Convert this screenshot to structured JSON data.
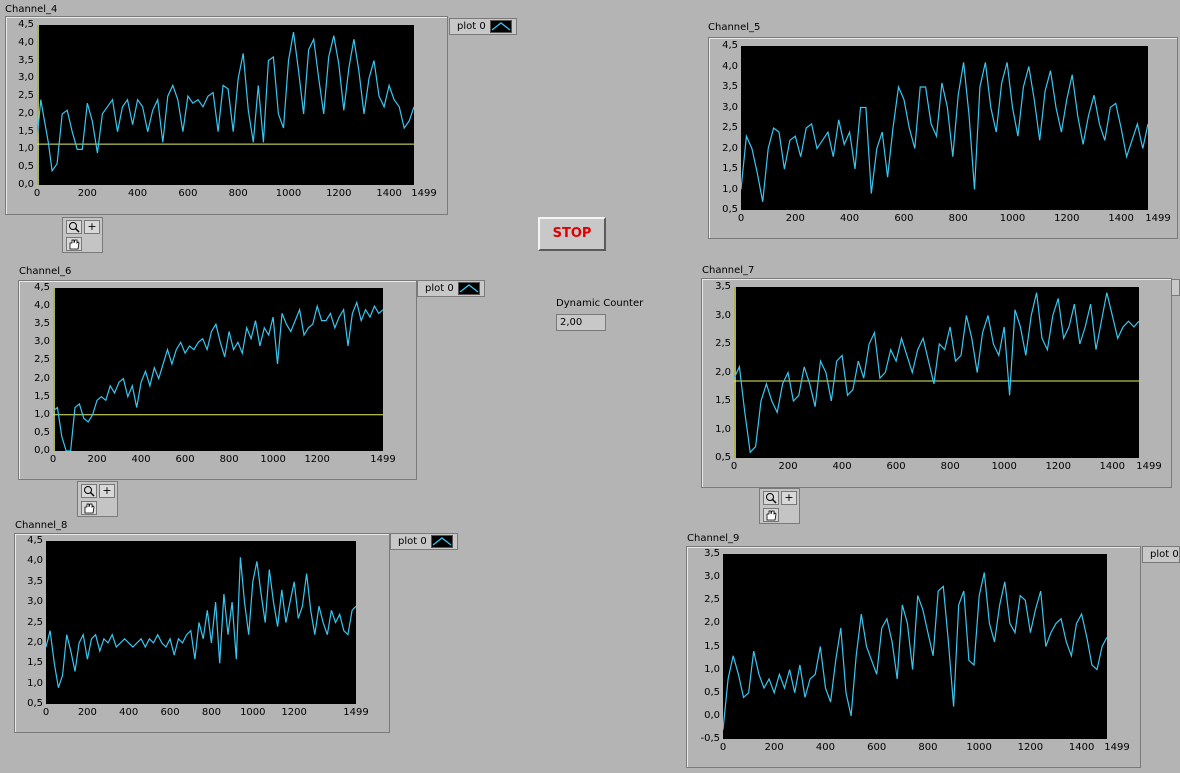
{
  "stop_button": {
    "label": "STOP"
  },
  "dynamic_counter": {
    "label": "Dynamic Counter",
    "value": "2,00"
  },
  "colors": {
    "trace": "#39c6f0",
    "cursor": "#e6f064",
    "plot_bg": "#000000"
  },
  "charts": [
    {
      "id": "ch4",
      "title": "Channel_4",
      "legend": "plot 0",
      "palette": true,
      "yticks": [
        "4,5",
        "4,0",
        "3,5",
        "3,0",
        "2,5",
        "2,0",
        "1,5",
        "1,0",
        "0,5",
        "0,0"
      ],
      "xticks": [
        "0",
        "200",
        "400",
        "600",
        "800",
        "1000",
        "1200",
        "1400",
        "1499"
      ],
      "chart_data": {
        "type": "line",
        "x_range": [
          0,
          1499
        ],
        "y_range": [
          0,
          4.5
        ],
        "cursor_y": 1.15,
        "x": [
          0,
          15,
          30,
          45,
          60,
          80,
          100,
          120,
          140,
          160,
          180,
          200,
          220,
          240,
          260,
          280,
          300,
          320,
          340,
          360,
          380,
          400,
          420,
          440,
          460,
          480,
          500,
          520,
          540,
          560,
          580,
          600,
          620,
          640,
          660,
          680,
          700,
          720,
          740,
          760,
          780,
          800,
          820,
          840,
          860,
          880,
          900,
          920,
          940,
          960,
          980,
          1000,
          1020,
          1040,
          1060,
          1080,
          1100,
          1120,
          1140,
          1160,
          1180,
          1200,
          1220,
          1240,
          1260,
          1280,
          1300,
          1320,
          1340,
          1360,
          1380,
          1400,
          1420,
          1440,
          1460,
          1480,
          1499
        ],
        "y": [
          1.3,
          2.4,
          1.8,
          1.2,
          0.4,
          0.6,
          2.0,
          2.1,
          1.5,
          1.0,
          1.0,
          2.3,
          1.8,
          0.9,
          2.0,
          2.2,
          2.4,
          1.5,
          2.2,
          2.4,
          1.7,
          2.4,
          2.2,
          1.5,
          2.1,
          2.4,
          1.2,
          2.5,
          2.8,
          2.4,
          1.5,
          2.5,
          2.3,
          2.4,
          2.2,
          2.5,
          2.6,
          1.5,
          2.8,
          2.7,
          1.5,
          3.0,
          3.7,
          2.1,
          1.2,
          2.8,
          1.2,
          3.5,
          3.6,
          2.0,
          1.6,
          3.5,
          4.3,
          3.2,
          2.0,
          3.8,
          4.1,
          3.0,
          2.0,
          3.6,
          4.2,
          3.4,
          2.1,
          3.3,
          4.1,
          3.2,
          2.0,
          3.0,
          3.5,
          2.5,
          2.2,
          2.8,
          2.4,
          2.2,
          1.6,
          1.8,
          2.2
        ]
      }
    },
    {
      "id": "ch5",
      "title": "Channel_5",
      "legend": "",
      "palette": false,
      "yticks": [
        "4,5",
        "4,0",
        "3,5",
        "3,0",
        "2,5",
        "2,0",
        "1,5",
        "1,0",
        "0,5"
      ],
      "xticks": [
        "0",
        "200",
        "400",
        "600",
        "800",
        "1000",
        "1200",
        "1400",
        "1499"
      ],
      "chart_data": {
        "type": "line",
        "x_range": [
          0,
          1499
        ],
        "y_range": [
          0.5,
          4.5
        ],
        "x": [
          0,
          20,
          40,
          60,
          80,
          100,
          120,
          140,
          160,
          180,
          200,
          220,
          240,
          260,
          280,
          300,
          320,
          340,
          360,
          380,
          400,
          420,
          440,
          460,
          480,
          500,
          520,
          540,
          560,
          580,
          600,
          620,
          640,
          660,
          680,
          700,
          720,
          740,
          760,
          780,
          800,
          820,
          840,
          860,
          880,
          900,
          920,
          940,
          960,
          980,
          1000,
          1020,
          1040,
          1060,
          1080,
          1100,
          1120,
          1140,
          1160,
          1180,
          1200,
          1220,
          1240,
          1260,
          1280,
          1300,
          1320,
          1340,
          1360,
          1380,
          1400,
          1420,
          1440,
          1460,
          1480,
          1499
        ],
        "y": [
          1.0,
          2.3,
          2.0,
          1.4,
          0.7,
          2.0,
          2.5,
          2.4,
          1.5,
          2.2,
          2.3,
          1.8,
          2.5,
          2.6,
          2.0,
          2.2,
          2.4,
          1.8,
          2.7,
          2.1,
          2.4,
          1.5,
          3.0,
          3.0,
          0.9,
          2.0,
          2.4,
          1.3,
          2.5,
          3.5,
          3.2,
          2.5,
          2.0,
          3.5,
          3.5,
          2.6,
          2.3,
          3.6,
          3.0,
          1.8,
          3.3,
          4.1,
          2.8,
          1.0,
          3.5,
          4.1,
          3.0,
          2.4,
          3.6,
          4.1,
          3.0,
          2.3,
          3.5,
          4.0,
          3.2,
          2.2,
          3.4,
          3.9,
          3.0,
          2.4,
          3.2,
          3.8,
          2.8,
          2.1,
          2.8,
          3.3,
          2.6,
          2.2,
          3.0,
          3.1,
          2.5,
          1.8,
          2.2,
          2.6,
          2.0,
          2.6
        ]
      }
    },
    {
      "id": "ch6",
      "title": "Channel_6",
      "legend": "plot 0",
      "palette": true,
      "yticks": [
        "4,5",
        "4,0",
        "3,5",
        "3,0",
        "2,5",
        "2,0",
        "1,5",
        "1,0",
        "0,5",
        "0,0"
      ],
      "xticks": [
        "0",
        "200",
        "400",
        "600",
        "800",
        "1000",
        "1200",
        "1499"
      ],
      "chart_data": {
        "type": "line",
        "x_range": [
          0,
          1499
        ],
        "y_range": [
          0,
          4.5
        ],
        "cursor_y": 1.0,
        "x": [
          0,
          20,
          40,
          60,
          80,
          100,
          120,
          140,
          160,
          180,
          200,
          220,
          240,
          260,
          280,
          300,
          320,
          340,
          360,
          380,
          400,
          420,
          440,
          460,
          480,
          500,
          520,
          540,
          560,
          580,
          600,
          620,
          640,
          660,
          680,
          700,
          720,
          740,
          760,
          780,
          800,
          820,
          840,
          860,
          880,
          900,
          920,
          940,
          960,
          980,
          1000,
          1020,
          1040,
          1060,
          1080,
          1100,
          1120,
          1140,
          1160,
          1180,
          1200,
          1220,
          1240,
          1260,
          1280,
          1300,
          1320,
          1340,
          1360,
          1380,
          1400,
          1420,
          1440,
          1460,
          1480,
          1499
        ],
        "y": [
          1.1,
          1.2,
          0.4,
          0.0,
          0.0,
          1.2,
          1.3,
          0.9,
          0.8,
          1.0,
          1.4,
          1.5,
          1.4,
          1.8,
          1.6,
          1.9,
          2.0,
          1.5,
          1.8,
          1.2,
          1.9,
          2.2,
          1.8,
          2.3,
          2.0,
          2.4,
          2.8,
          2.4,
          2.8,
          3.0,
          2.7,
          2.9,
          2.8,
          3.0,
          3.1,
          2.8,
          3.3,
          3.5,
          3.0,
          2.6,
          3.3,
          2.8,
          3.0,
          2.7,
          3.4,
          3.1,
          3.6,
          2.9,
          3.4,
          3.2,
          3.7,
          2.4,
          3.8,
          3.5,
          3.3,
          3.6,
          3.9,
          3.2,
          3.4,
          3.5,
          4.0,
          3.6,
          3.6,
          3.8,
          3.4,
          3.7,
          3.9,
          2.9,
          3.8,
          4.1,
          3.6,
          3.9,
          3.7,
          4.0,
          3.8,
          3.9
        ]
      }
    },
    {
      "id": "ch7",
      "title": "Channel_7",
      "legend": "",
      "palette": true,
      "yticks": [
        "3,5",
        "3,0",
        "2,5",
        "2,0",
        "1,5",
        "1,0",
        "0,5"
      ],
      "xticks": [
        "0",
        "200",
        "400",
        "600",
        "800",
        "1000",
        "1200",
        "1400",
        "1499"
      ],
      "chart_data": {
        "type": "line",
        "x_range": [
          0,
          1499
        ],
        "y_range": [
          0.5,
          3.5
        ],
        "cursor_y": 1.85,
        "x": [
          0,
          20,
          40,
          60,
          80,
          100,
          120,
          140,
          160,
          180,
          200,
          220,
          240,
          260,
          280,
          300,
          320,
          340,
          360,
          380,
          400,
          420,
          440,
          460,
          480,
          500,
          520,
          540,
          560,
          580,
          600,
          620,
          640,
          660,
          680,
          700,
          720,
          740,
          760,
          780,
          800,
          820,
          840,
          860,
          880,
          900,
          920,
          940,
          960,
          980,
          1000,
          1020,
          1040,
          1060,
          1080,
          1100,
          1120,
          1140,
          1160,
          1180,
          1200,
          1220,
          1240,
          1260,
          1280,
          1300,
          1320,
          1340,
          1360,
          1380,
          1400,
          1420,
          1440,
          1460,
          1480,
          1499
        ],
        "y": [
          1.9,
          2.1,
          1.3,
          0.6,
          0.7,
          1.5,
          1.8,
          1.5,
          1.3,
          1.8,
          2.0,
          1.5,
          1.6,
          2.1,
          1.8,
          1.4,
          2.2,
          2.0,
          1.5,
          2.2,
          2.3,
          1.6,
          1.7,
          2.2,
          1.9,
          2.5,
          2.7,
          1.9,
          2.0,
          2.4,
          2.2,
          2.6,
          2.3,
          2.0,
          2.4,
          2.6,
          2.2,
          1.8,
          2.5,
          2.4,
          2.8,
          2.2,
          2.3,
          3.0,
          2.6,
          2.0,
          2.7,
          3.0,
          2.5,
          2.3,
          2.8,
          1.6,
          3.1,
          2.8,
          2.3,
          3.0,
          3.4,
          2.6,
          2.4,
          3.0,
          3.3,
          2.6,
          2.8,
          3.2,
          2.5,
          2.8,
          3.2,
          2.4,
          2.9,
          3.4,
          3.0,
          2.6,
          2.8,
          2.9,
          2.8,
          2.9
        ]
      }
    },
    {
      "id": "ch8",
      "title": "Channel_8",
      "legend": "plot 0",
      "palette": false,
      "yticks": [
        "4,5",
        "4,0",
        "3,5",
        "3,0",
        "2,5",
        "2,0",
        "1,5",
        "1,0",
        "0,5"
      ],
      "xticks": [
        "0",
        "200",
        "400",
        "600",
        "800",
        "1000",
        "1200",
        "1499"
      ],
      "chart_data": {
        "type": "line",
        "x_range": [
          0,
          1499
        ],
        "y_range": [
          0.5,
          4.5
        ],
        "x": [
          0,
          20,
          40,
          60,
          80,
          100,
          120,
          140,
          160,
          180,
          200,
          220,
          240,
          260,
          280,
          300,
          320,
          340,
          360,
          380,
          400,
          420,
          440,
          460,
          480,
          500,
          520,
          540,
          560,
          580,
          600,
          620,
          640,
          660,
          680,
          700,
          720,
          740,
          760,
          780,
          800,
          820,
          840,
          860,
          880,
          900,
          920,
          940,
          960,
          980,
          1000,
          1020,
          1040,
          1060,
          1080,
          1100,
          1120,
          1140,
          1160,
          1180,
          1200,
          1220,
          1240,
          1260,
          1280,
          1300,
          1320,
          1340,
          1360,
          1380,
          1400,
          1420,
          1440,
          1460,
          1480,
          1499
        ],
        "y": [
          1.9,
          2.3,
          1.5,
          0.9,
          1.2,
          2.2,
          1.8,
          1.3,
          2.0,
          2.2,
          1.6,
          2.1,
          2.2,
          1.8,
          2.1,
          2.0,
          2.2,
          1.9,
          2.0,
          2.1,
          2.0,
          1.9,
          2.0,
          2.1,
          1.9,
          2.1,
          2.0,
          2.2,
          2.0,
          1.9,
          2.1,
          1.7,
          2.1,
          2.0,
          2.2,
          2.3,
          1.6,
          2.5,
          2.1,
          2.8,
          2.0,
          3.0,
          1.5,
          3.2,
          2.2,
          3.0,
          1.6,
          4.1,
          3.0,
          2.2,
          3.5,
          4.0,
          3.2,
          2.5,
          3.8,
          3.0,
          2.4,
          3.3,
          2.5,
          3.0,
          3.5,
          2.6,
          2.9,
          3.7,
          2.8,
          2.2,
          2.9,
          2.5,
          2.2,
          2.8,
          2.5,
          2.7,
          2.3,
          2.2,
          2.8,
          2.9
        ]
      }
    },
    {
      "id": "ch9",
      "title": "Channel_9",
      "legend": "plot 0",
      "palette": false,
      "yticks": [
        "3,5",
        "3,0",
        "2,5",
        "2,0",
        "1,5",
        "1,0",
        "0,5",
        "0,0",
        "-0,5"
      ],
      "xticks": [
        "0",
        "200",
        "400",
        "600",
        "800",
        "1000",
        "1200",
        "1400",
        "1499"
      ],
      "chart_data": {
        "type": "line",
        "x_range": [
          0,
          1499
        ],
        "y_range": [
          -0.5,
          3.5
        ],
        "x": [
          0,
          20,
          40,
          60,
          80,
          100,
          120,
          140,
          160,
          180,
          200,
          220,
          240,
          260,
          280,
          300,
          320,
          340,
          360,
          380,
          400,
          420,
          440,
          460,
          480,
          500,
          520,
          540,
          560,
          580,
          600,
          620,
          640,
          660,
          680,
          700,
          720,
          740,
          760,
          780,
          800,
          820,
          840,
          860,
          880,
          900,
          920,
          940,
          960,
          980,
          1000,
          1020,
          1040,
          1060,
          1080,
          1100,
          1120,
          1140,
          1160,
          1180,
          1200,
          1220,
          1240,
          1260,
          1280,
          1300,
          1320,
          1340,
          1360,
          1380,
          1400,
          1420,
          1440,
          1460,
          1480,
          1499
        ],
        "y": [
          -0.3,
          0.8,
          1.3,
          0.9,
          0.4,
          0.5,
          1.4,
          0.9,
          0.6,
          0.8,
          0.5,
          0.9,
          0.6,
          1.0,
          0.5,
          1.1,
          0.4,
          0.8,
          0.9,
          1.5,
          0.6,
          0.3,
          1.2,
          1.9,
          0.5,
          0.0,
          1.3,
          2.2,
          1.5,
          1.2,
          0.9,
          1.9,
          2.1,
          1.6,
          0.8,
          2.4,
          2.0,
          1.0,
          2.6,
          2.3,
          1.8,
          1.3,
          2.7,
          2.8,
          1.6,
          0.2,
          2.4,
          2.7,
          1.2,
          1.1,
          2.6,
          3.1,
          2.0,
          1.6,
          2.4,
          2.9,
          2.0,
          1.8,
          2.6,
          2.5,
          1.8,
          2.3,
          2.7,
          1.5,
          1.8,
          2.0,
          2.1,
          1.6,
          1.3,
          2.0,
          2.2,
          1.7,
          1.1,
          1.0,
          1.5,
          1.7
        ]
      }
    }
  ]
}
